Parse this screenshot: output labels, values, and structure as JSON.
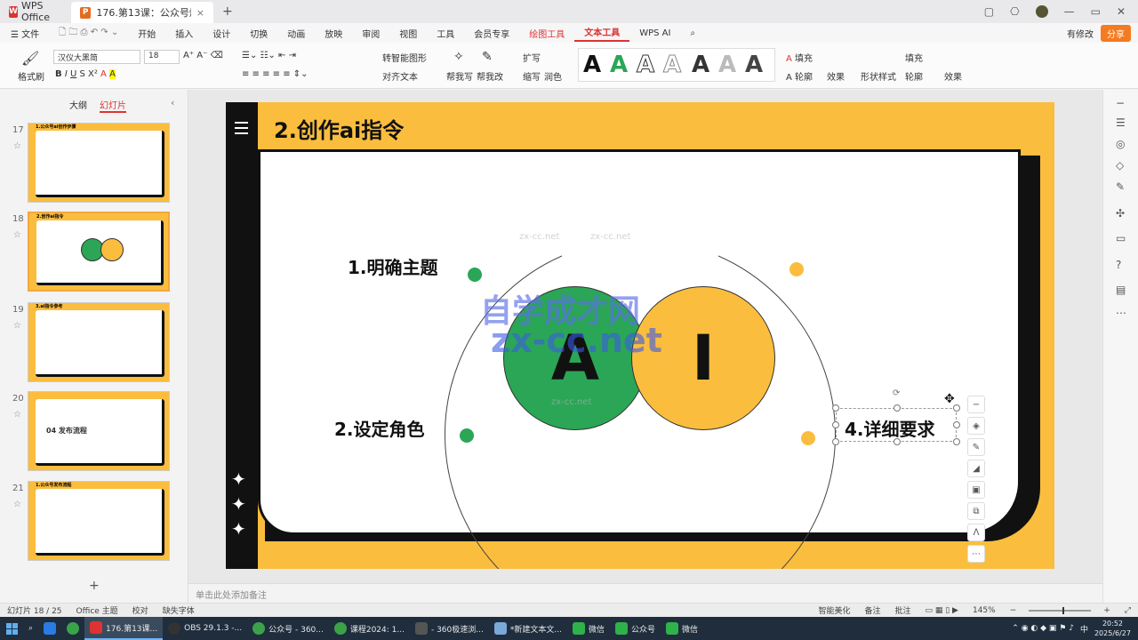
{
  "titlebar": {
    "app_tab": "WPS Office",
    "doc_tab": "176.第13课：公众号爆款法则-ai",
    "doc_close": "×",
    "new_tab": "+",
    "window_icons": [
      "▢",
      "⎔",
      "—",
      "▭",
      "✕"
    ]
  },
  "menubar": {
    "file": "文件",
    "items": [
      "开始",
      "插入",
      "设计",
      "切换",
      "动画",
      "放映",
      "审阅",
      "视图",
      "工具",
      "会员专享"
    ],
    "draw_tools": "绘图工具",
    "text_tools": "文本工具",
    "wps_ai": "WPS AI",
    "has_edit": "有修改",
    "share": "分享"
  },
  "ribbon": {
    "format_painter": "格式刷",
    "font_name": "汉仪大黑简",
    "font_size": "18",
    "smart_shape": "转智能图形",
    "align_text": "对齐文本",
    "write_help": "帮我写",
    "edit_help": "帮我改",
    "expand": "扩写",
    "shrink": "缩写",
    "polish": "润色",
    "art_samples": [
      "A",
      "A",
      "A",
      "A",
      "A",
      "A",
      "A"
    ],
    "fill": "填充",
    "outline": "轮廓",
    "effect": "效果",
    "shape_style": "形状样式",
    "fill2": "填充",
    "outline2": "轮廓",
    "effect2": "效果"
  },
  "leftpanel": {
    "tabs": [
      "大纲",
      "幻灯片"
    ],
    "collapse": "‹",
    "add": "+",
    "thumbs": [
      {
        "num": "17",
        "title": "1.公众号ai创作步骤"
      },
      {
        "num": "18",
        "title": "2.创作ai指令"
      },
      {
        "num": "19",
        "title": "3.ai指令参考"
      },
      {
        "num": "20",
        "title": "04 发布流程"
      },
      {
        "num": "21",
        "title": "1.公众号发布流程"
      }
    ]
  },
  "slide": {
    "title": "2.创作ai指令",
    "label1": "1.明确主题",
    "label2": "2.设定角色",
    "label4": "4.详细要求",
    "circle_a": "A",
    "circle_i": "I",
    "watermark_cn": "自学成才网",
    "watermark_en": "zx-cc.net",
    "watermark_small": "zx-cc.net",
    "colors": {
      "green": "#2aa656",
      "yellow": "#fbbd3e",
      "black": "#111111"
    }
  },
  "notes": {
    "placeholder": "单击此处添加备注"
  },
  "statusbar": {
    "slide_count": "幻灯片 18 / 25",
    "theme": "Office 主题",
    "proof": "校对",
    "missing_font": "缺失字体",
    "smart_beautify": "智能美化",
    "notes": "备注",
    "comments": "批注",
    "zoom": "145%"
  },
  "taskbar": {
    "apps": [
      "176.第13课...",
      "OBS 29.1.3 -...",
      "公众号 - 360...",
      "课程2024: 1...",
      "- 360极速浏...",
      "*新建文本文...",
      "微信",
      "公众号",
      "微信"
    ],
    "lang": "中",
    "time": "20:52",
    "date": "2025/6/27"
  }
}
